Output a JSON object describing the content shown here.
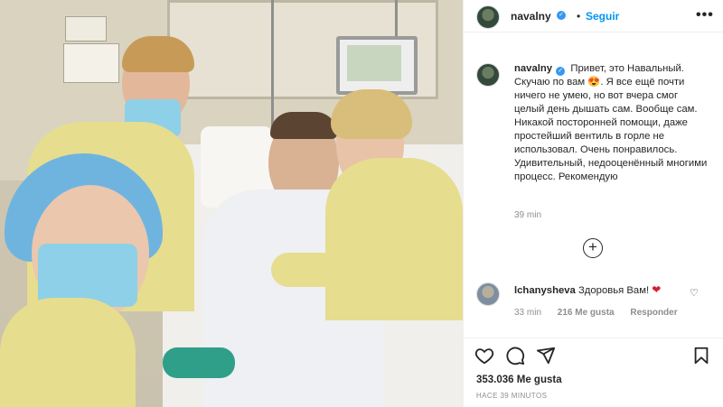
{
  "post": {
    "username": "navalny",
    "follow_label": "Seguir",
    "separator": "•",
    "more_label": "•••",
    "caption": "Привет, это Навальный. Скучаю по вам 😍. Я все ещё почти ничего не умею, но вот вчера смог целый день дышать сам. Вообще сам. Никакой посторонней помощи, даже простейший вентиль в горле не использовал. Очень понравилось. Удивительный, недооценённый многими процесс. Рекомендую",
    "caption_time": "39 min",
    "load_more_label": "+",
    "likes": "353.036 Me gusta",
    "time_ago": "HACE 39 MINUTOS"
  },
  "comments": [
    {
      "username": "lchanysheva",
      "text": "Здоровья Вам!",
      "emoji": "❤",
      "time": "33 min",
      "likes": "216 Me gusta",
      "reply_label": "Responder",
      "like_icon": "♡"
    }
  ],
  "icons": {
    "verified": "verified-badge-icon",
    "heart": "heart-icon",
    "comment": "comment-icon",
    "share": "share-icon",
    "save": "bookmark-icon",
    "add": "plus-circle-icon"
  },
  "colors": {
    "accent": "#0095f6",
    "verified": "#3897f0",
    "text": "#262626",
    "muted": "#8e8e8e",
    "heart_emoji": "#d61f33"
  }
}
